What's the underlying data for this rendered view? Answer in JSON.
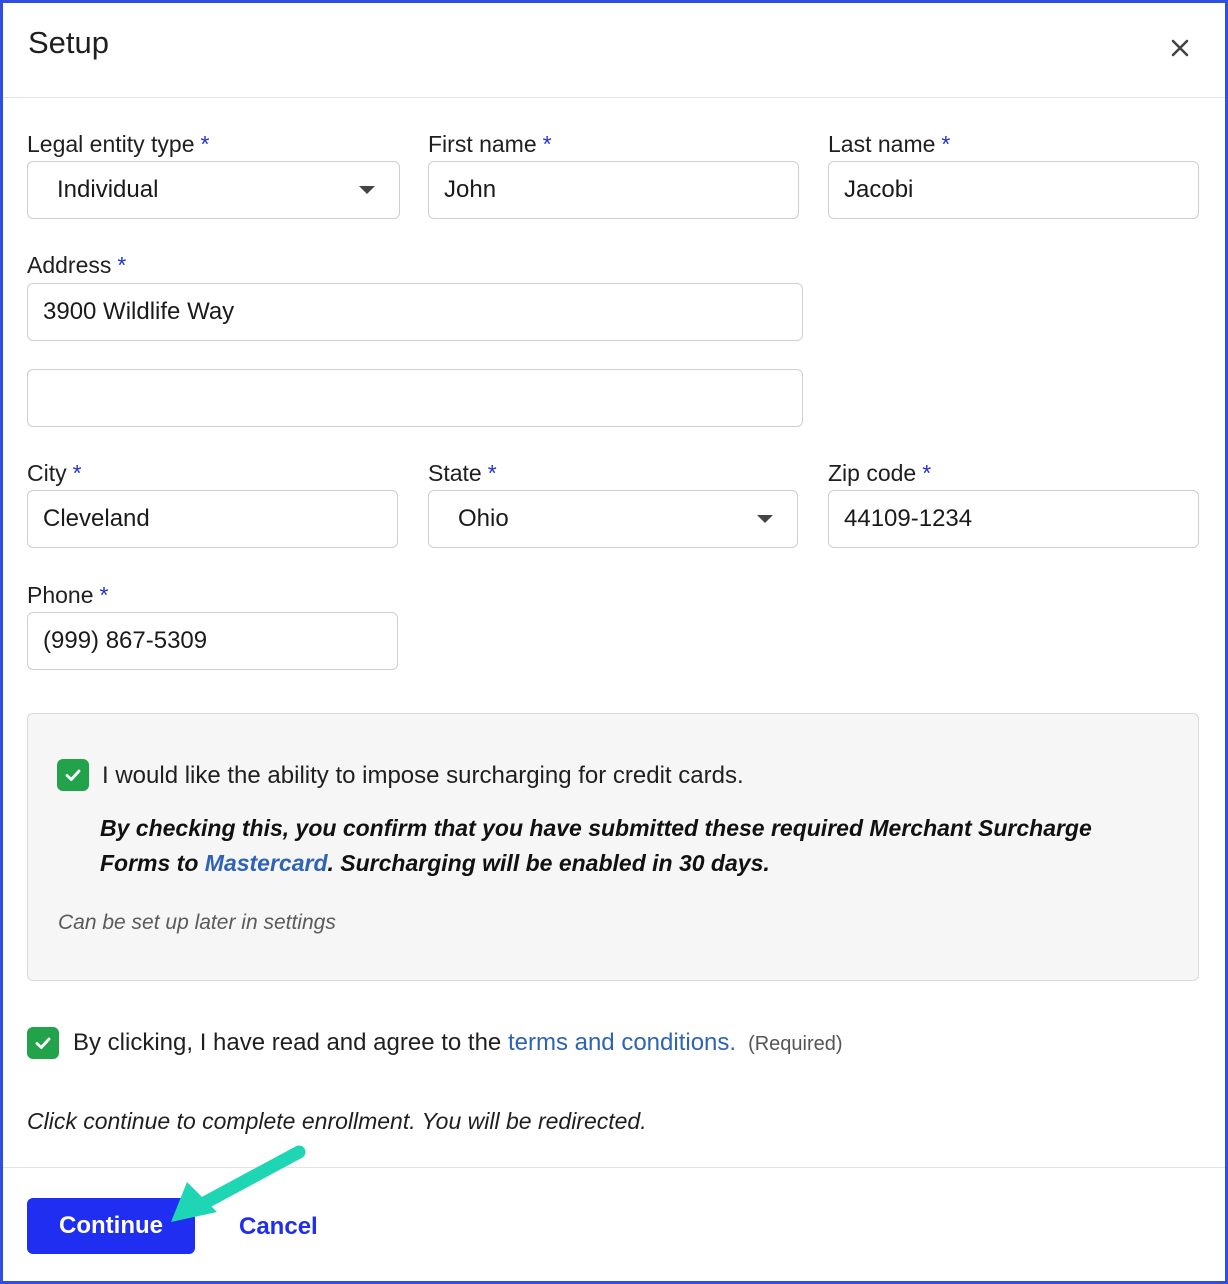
{
  "dialog": {
    "title": "Setup",
    "close_icon": "close-icon"
  },
  "required_marker": "*",
  "form": {
    "legal_entity": {
      "label": "Legal entity type",
      "value": "Individual"
    },
    "first_name": {
      "label": "First name",
      "value": "John"
    },
    "last_name": {
      "label": "Last name",
      "value": "Jacobi"
    },
    "address": {
      "label": "Address",
      "line1": "3900 Wildlife Way",
      "line2": ""
    },
    "city": {
      "label": "City",
      "value": "Cleveland"
    },
    "state": {
      "label": "State",
      "value": "Ohio"
    },
    "zip": {
      "label": "Zip code",
      "value": "44109-1234"
    },
    "phone": {
      "label": "Phone",
      "value": "(999) 867-5309"
    }
  },
  "surcharge": {
    "checked": true,
    "label": "I would like the ability to impose surcharging for credit cards.",
    "confirm_before": "By checking this, you confirm that you have submitted these required Merchant Surcharge Forms to ",
    "confirm_link": "Mastercard",
    "confirm_after": ". Surcharging will be enabled in 30 days.",
    "note": "Can be set up later in settings"
  },
  "terms": {
    "checked": true,
    "label_before": "By clicking, I have read and agree to the ",
    "link": "terms and conditions.",
    "required": "(Required)"
  },
  "redirect_note": "Click continue to complete enrollment. You will be redirected.",
  "actions": {
    "continue_label": "Continue",
    "cancel_label": "Cancel"
  },
  "colors": {
    "frame_border": "#2f4fe0",
    "primary": "#1f2ef0",
    "checkbox": "#22a24a",
    "link": "#2f63b5",
    "arrow": "#1fd6b4"
  }
}
